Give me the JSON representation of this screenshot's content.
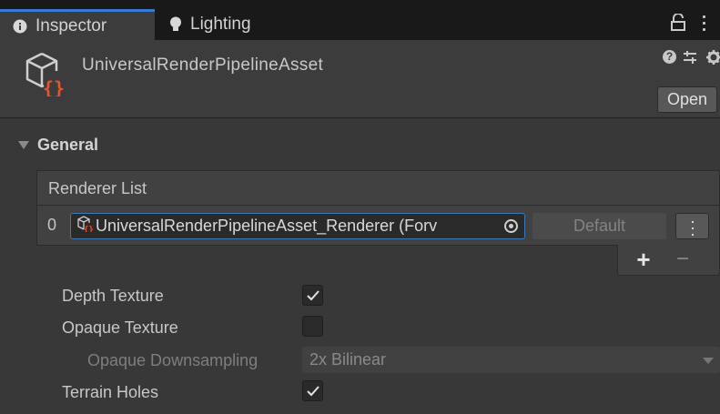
{
  "tabs": [
    {
      "label": "Inspector",
      "icon": "info-icon",
      "active": true
    },
    {
      "label": "Lighting",
      "icon": "lightbulb-icon",
      "active": false
    }
  ],
  "header": {
    "asset_title": "UniversalRenderPipelineAsset",
    "open_label": "Open",
    "icons": [
      "help-icon",
      "preset-icon",
      "gear-icon"
    ]
  },
  "general": {
    "title": "General",
    "renderer_list": {
      "header": "Renderer List",
      "rows": [
        {
          "index": "0",
          "value": "UniversalRenderPipelineAsset_Renderer (Forv",
          "default_label": "Default"
        }
      ]
    },
    "properties": [
      {
        "label": "Depth Texture",
        "type": "checkbox",
        "checked": true
      },
      {
        "label": "Opaque Texture",
        "type": "checkbox",
        "checked": false
      },
      {
        "label": "Opaque Downsampling",
        "type": "dropdown",
        "value": "2x Bilinear",
        "disabled": true
      },
      {
        "label": "Terrain Holes",
        "type": "checkbox",
        "checked": true
      }
    ]
  },
  "colors": {
    "accent": "#3a78d6",
    "panel": "#383838",
    "tabbar": "#191919",
    "asset_brace": "#e8542f"
  }
}
